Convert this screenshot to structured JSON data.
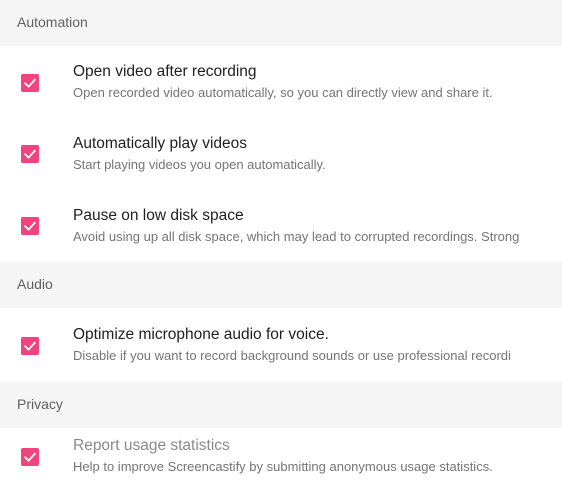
{
  "sections": [
    {
      "label": "Automation",
      "items": [
        {
          "title": "Open video after recording",
          "description": "Open recorded video automatically, so you can directly view and share it.",
          "checked": true
        },
        {
          "title": "Automatically play videos",
          "description": "Start playing videos you open automatically.",
          "checked": true
        },
        {
          "title": "Pause on low disk space",
          "description": "Avoid using up all disk space, which may lead to corrupted recordings. Strong",
          "checked": true
        }
      ]
    },
    {
      "label": "Audio",
      "items": [
        {
          "title": "Optimize microphone audio for voice.",
          "description": "Disable if you want to record background sounds or use professional recordi",
          "checked": true
        }
      ]
    },
    {
      "label": "Privacy",
      "items": [
        {
          "title": "Report usage statistics",
          "description": "Help to improve Screencastify by submitting anonymous usage statistics.",
          "checked": true
        }
      ]
    }
  ],
  "colors": {
    "checkbox_accent": "#f0447e",
    "section_background": "#f5f5f5"
  },
  "icons": {
    "checkbox": "check-icon"
  }
}
